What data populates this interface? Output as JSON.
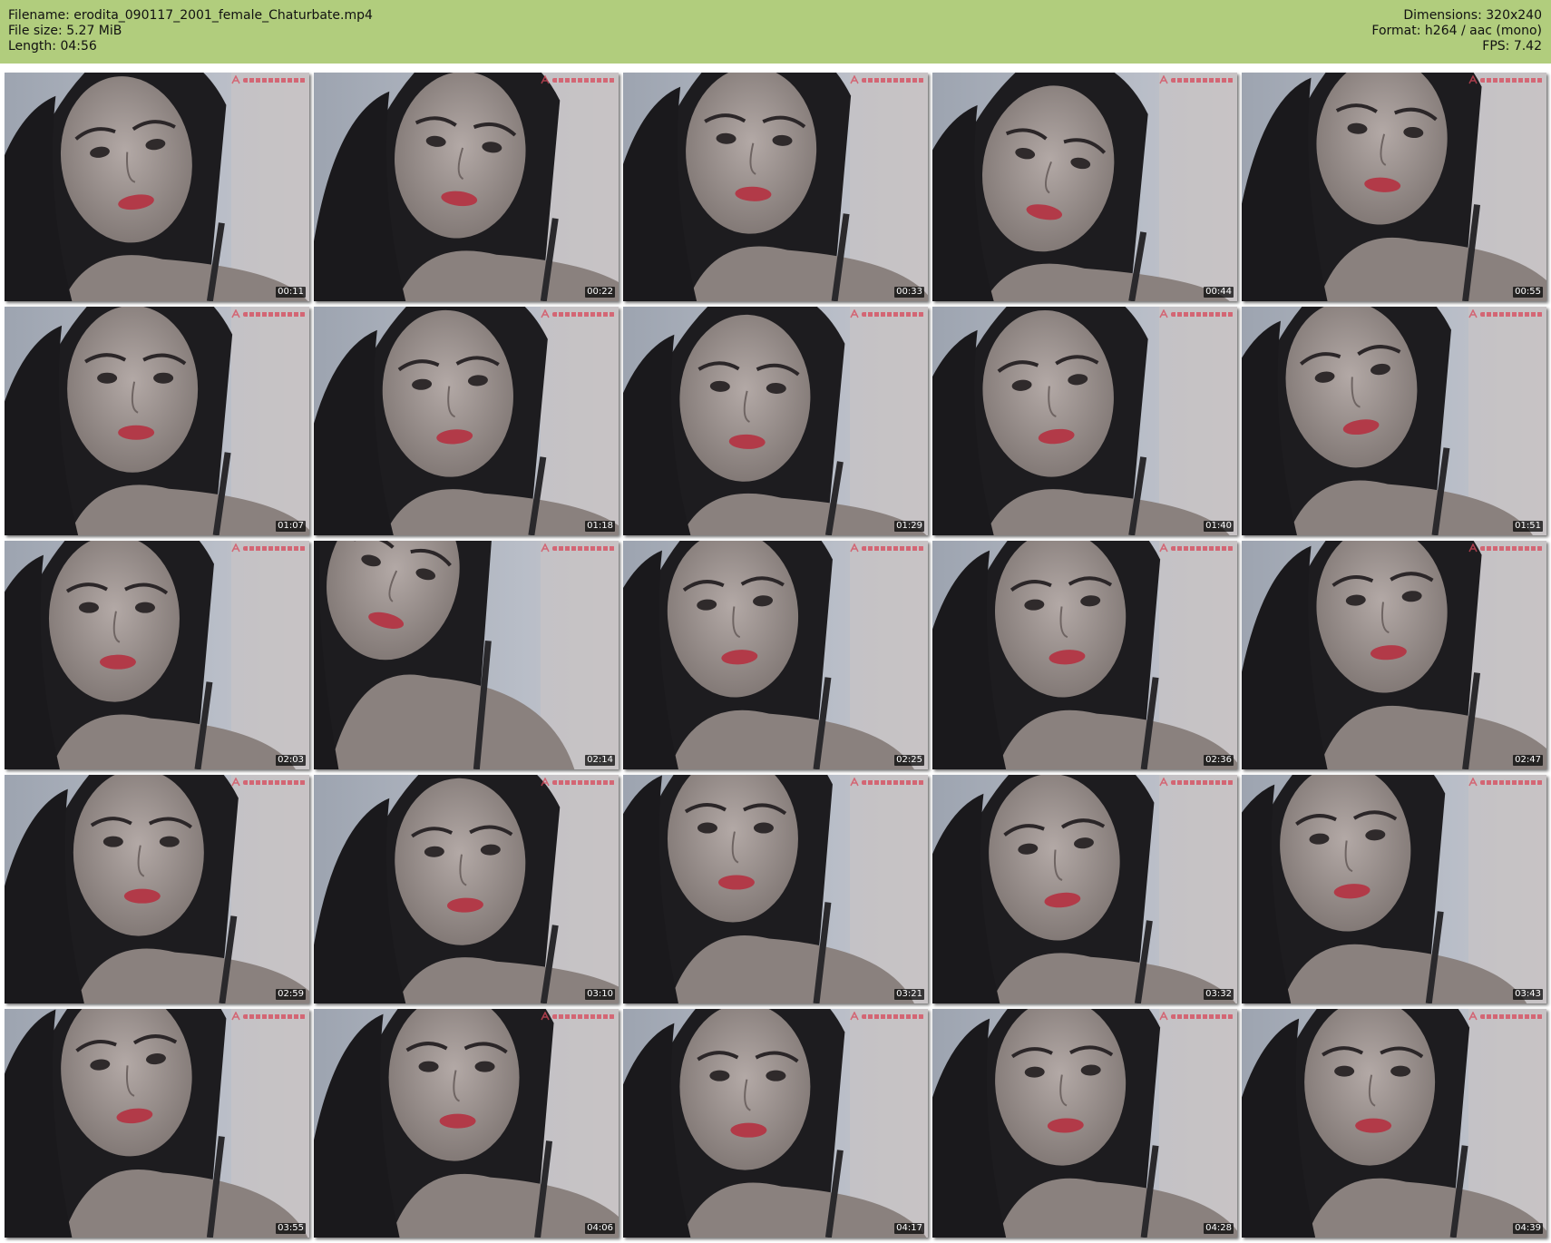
{
  "header": {
    "filename_label": "Filename: erodita_090117_2001_female_Chaturbate.mp4",
    "filesize_label": "File size: 5.27 MiB",
    "length_label": "Length: 04:56",
    "dimensions_label": "Dimensions: 320x240",
    "format_label": "Format: h264 / aac (mono)",
    "fps_label": "FPS: 7.42",
    "background_color": "#b1cd7d"
  },
  "frames": [
    {
      "timestamp": "00:11"
    },
    {
      "timestamp": "00:22"
    },
    {
      "timestamp": "00:33"
    },
    {
      "timestamp": "00:44"
    },
    {
      "timestamp": "00:55"
    },
    {
      "timestamp": "01:07"
    },
    {
      "timestamp": "01:18"
    },
    {
      "timestamp": "01:29"
    },
    {
      "timestamp": "01:40"
    },
    {
      "timestamp": "01:51"
    },
    {
      "timestamp": "02:03"
    },
    {
      "timestamp": "02:14"
    },
    {
      "timestamp": "02:25"
    },
    {
      "timestamp": "02:36"
    },
    {
      "timestamp": "02:47"
    },
    {
      "timestamp": "02:59"
    },
    {
      "timestamp": "03:10"
    },
    {
      "timestamp": "03:21"
    },
    {
      "timestamp": "03:32"
    },
    {
      "timestamp": "03:43"
    },
    {
      "timestamp": "03:55"
    },
    {
      "timestamp": "04:06"
    },
    {
      "timestamp": "04:17"
    },
    {
      "timestamp": "04:28"
    },
    {
      "timestamp": "04:39"
    }
  ]
}
